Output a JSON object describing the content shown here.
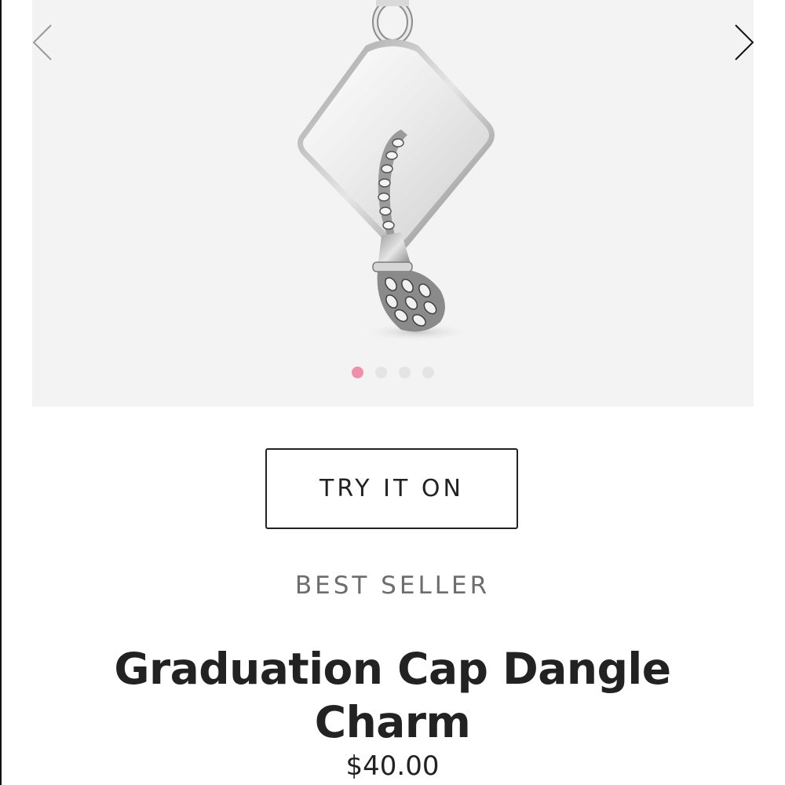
{
  "gallery": {
    "image_alt": "Graduation cap dangle charm, sterling silver",
    "prev_icon": "chevron-left-icon",
    "next_icon": "chevron-right-icon",
    "slides": 4,
    "active_slide": 1,
    "active_dot_color": "#ef8fa9",
    "inactive_dot_color": "#e4e4e4"
  },
  "actions": {
    "try_on_label": "TRY IT ON"
  },
  "product": {
    "badge": "BEST SELLER",
    "title_line1": "Graduation Cap Dangle",
    "title_line2": "Charm",
    "price": "$40.00"
  }
}
